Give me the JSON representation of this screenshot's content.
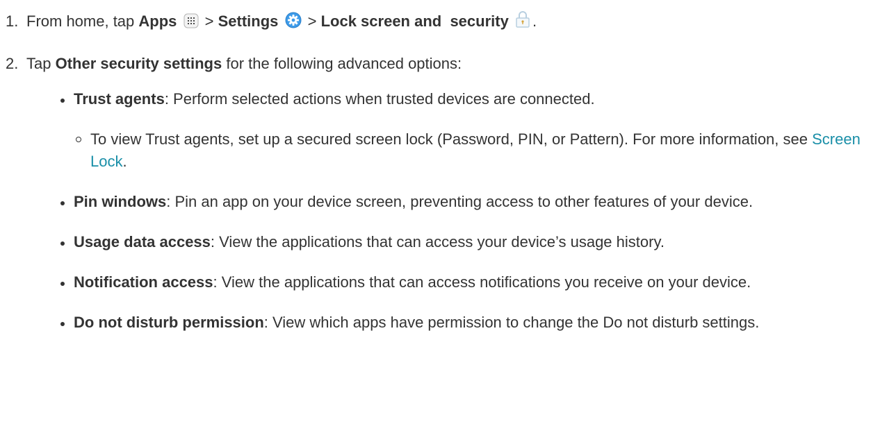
{
  "steps": [
    {
      "number": "1.",
      "intro": "From home, tap ",
      "apps": "Apps",
      "sep1": " > ",
      "settings": "Settings",
      "sep2": " > ",
      "lock": "Lock screen and  security",
      "end": "."
    },
    {
      "number": "2.",
      "intro": "Tap ",
      "bold": "Other security settings",
      "rest": " for the following advanced options:"
    }
  ],
  "options": [
    {
      "term": "Trust agents",
      "desc": ": Perform selected actions when trusted devices are connected."
    },
    {
      "term": "Pin windows",
      "desc": ": Pin an app on your device screen, preventing access to other features of your device."
    },
    {
      "term": "Usage data access",
      "desc": ": View the applications that can access your device’s usage history."
    },
    {
      "term": "Notification access",
      "desc": ": View the applications that can access notifications you receive on your device."
    },
    {
      "term": "Do not disturb permission",
      "desc": ": View which apps have permission to change the Do not disturb settings."
    }
  ],
  "trust_sub": {
    "text": "To view Trust agents, set up a secured screen lock (Password, PIN, or Pattern). For more information, see ",
    "link": "Screen Lock",
    "end": "."
  },
  "icons": {
    "apps": "apps-grid-icon",
    "settings": "settings-gear-icon",
    "lock": "lock-icon"
  },
  "colors": {
    "text": "#333333",
    "link": "#1a8fa8",
    "settings_icon": "#3d9be9"
  }
}
